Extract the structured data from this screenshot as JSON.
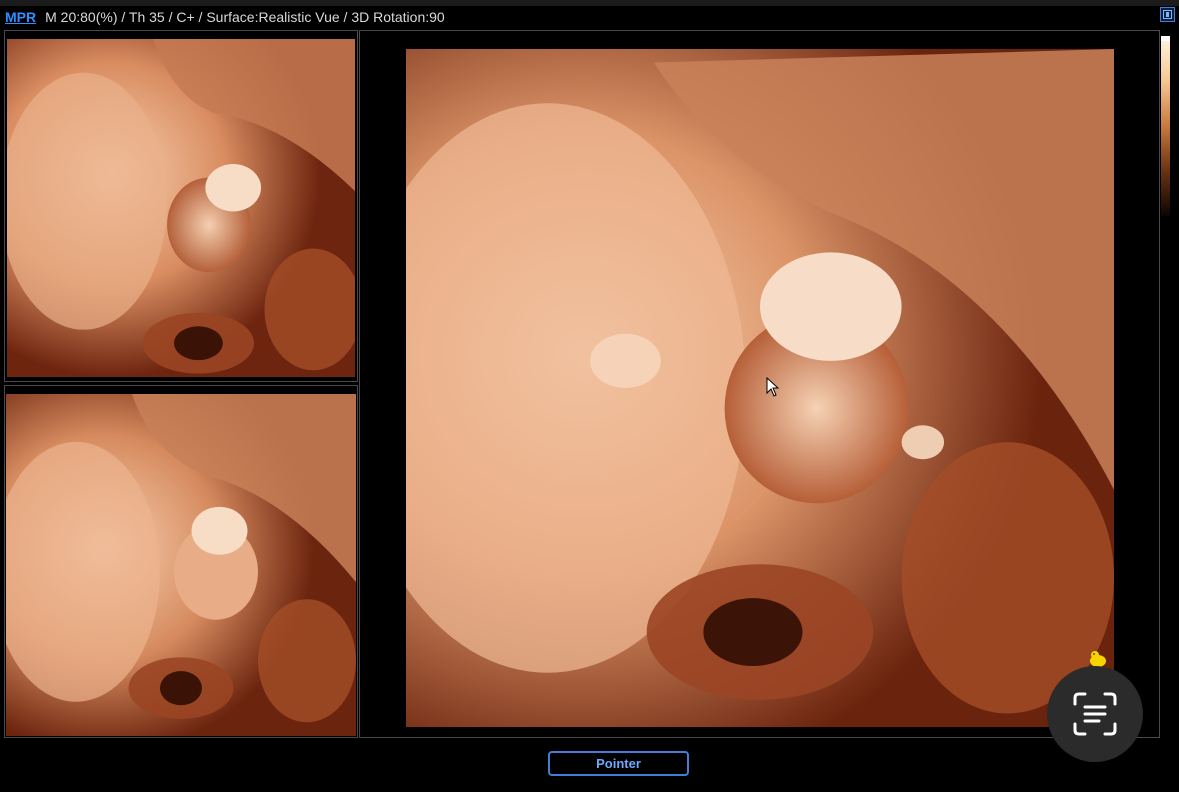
{
  "status": {
    "mode_label": "MPR",
    "info": "M 20:80(%) / Th 35 / C+ / Surface:Realistic Vue / 3D Rotation:90"
  },
  "toolbar": {
    "pointer_label": "Pointer"
  },
  "icons": {
    "screen": "screen-icon",
    "scan": "text-scan-icon",
    "chick": "chick-icon",
    "cursor": "mouse-cursor-icon"
  },
  "colors": {
    "accent_blue": "#2f8fff",
    "tissue_light": "#f3c4a2",
    "tissue_mid": "#c9774c",
    "tissue_dark": "#5b1c0a",
    "background": "#000000"
  },
  "viewports": [
    {
      "id": "top-left",
      "content": "3D ultrasound render"
    },
    {
      "id": "bottom-left",
      "content": "3D ultrasound render"
    },
    {
      "id": "main",
      "content": "3D ultrasound render"
    }
  ]
}
